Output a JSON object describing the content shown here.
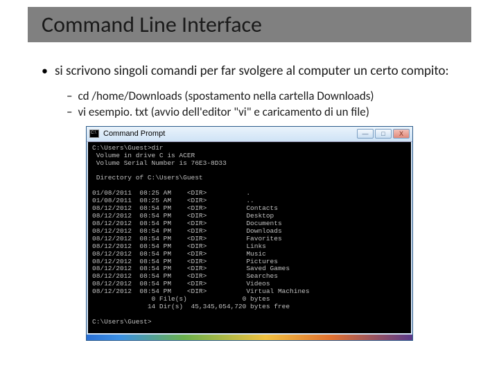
{
  "title": "Command Line Interface",
  "main_bullet": "si scrivono singoli comandi per far svolgere al computer un certo compito:",
  "sub_items": [
    "cd /home/Downloads (spostamento nella cartella Downloads)",
    "vi esempio. txt (avvio dell'editor \"vi\" e caricamento di un file)"
  ],
  "window": {
    "title": "Command Prompt",
    "min": "—",
    "max": "□",
    "close": "X"
  },
  "terminal": {
    "prompt1": "C:\\Users\\Guest>dir",
    "vol": " Volume in drive C is ACER",
    "serial": " Volume Serial Number is 76E3-8D33",
    "blank": "",
    "dirof": " Directory of C:\\Users\\Guest",
    "rows": [
      "01/08/2011  08:25 AM    <DIR>          .",
      "01/08/2011  08:25 AM    <DIR>          ..",
      "08/12/2012  08:54 PM    <DIR>          Contacts",
      "08/12/2012  08:54 PM    <DIR>          Desktop",
      "08/12/2012  08:54 PM    <DIR>          Documents",
      "08/12/2012  08:54 PM    <DIR>          Downloads",
      "08/12/2012  08:54 PM    <DIR>          Favorites",
      "08/12/2012  08:54 PM    <DIR>          Links",
      "08/12/2012  08:54 PM    <DIR>          Music",
      "08/12/2012  08:54 PM    <DIR>          Pictures",
      "08/12/2012  08:54 PM    <DIR>          Saved Games",
      "08/12/2012  08:54 PM    <DIR>          Searches",
      "08/12/2012  08:54 PM    <DIR>          Videos",
      "08/12/2012  08:54 PM    <DIR>          Virtual Machines"
    ],
    "summary1": "               0 File(s)              0 bytes",
    "summary2": "              14 Dir(s)  45,345,054,720 bytes free",
    "prompt2": "C:\\Users\\Guest>"
  }
}
